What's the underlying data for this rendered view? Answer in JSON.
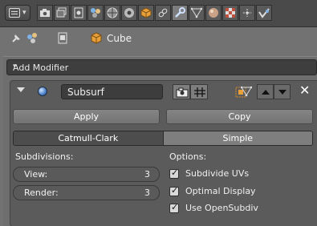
{
  "panel": {
    "add_modifier": "Add Modifier"
  },
  "context": {
    "object_name": "Cube"
  },
  "modifier": {
    "name": "Subsurf",
    "apply_label": "Apply",
    "copy_label": "Copy",
    "type_options": [
      "Catmull-Clark",
      "Simple"
    ],
    "selected_type": "Catmull-Clark",
    "subdivisions_heading": "Subdivisions:",
    "view_label": "View:",
    "view_value": "3",
    "render_label": "Render:",
    "render_value": "3",
    "options_heading": "Options:",
    "options": [
      {
        "label": "Subdivide UVs",
        "checked": true
      },
      {
        "label": "Optimal Display",
        "checked": true
      },
      {
        "label": "Use OpenSubdiv",
        "checked": true
      }
    ]
  },
  "icons": {
    "tabs": [
      "render-icon",
      "render-layers-icon",
      "scene-icon",
      "world-icon",
      "object-icon",
      "constraints-icon",
      "modifiers-icon",
      "data-icon",
      "material-icon",
      "texture-icon",
      "particles-icon",
      "physics-icon"
    ],
    "active_tab": "modifiers-icon"
  },
  "colors": {
    "background": "#727272",
    "header": "#4a4a4a",
    "modifier_box": "#5b5b5b",
    "accent_orange": "#e8a13a"
  }
}
